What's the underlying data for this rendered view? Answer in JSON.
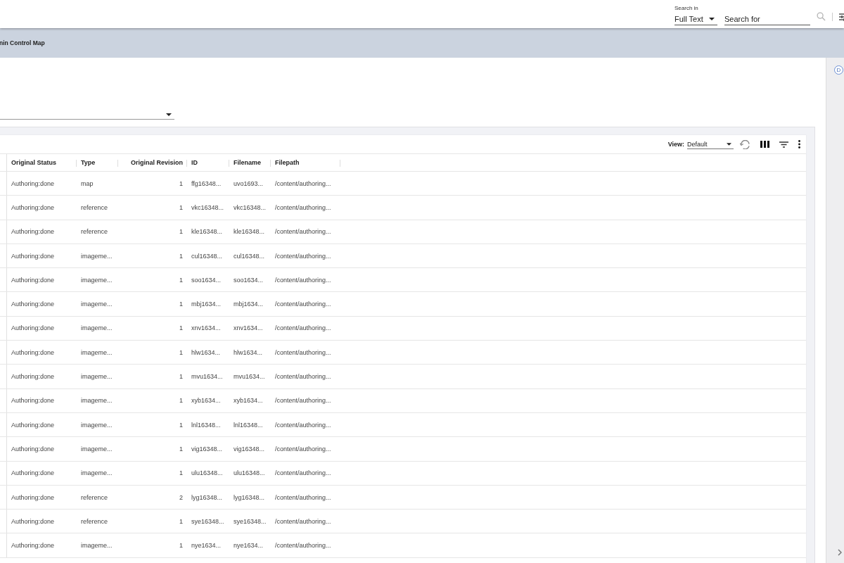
{
  "header": {
    "search_in_label": "Search in",
    "search_scope": "Full Text",
    "search_field": {
      "placeholder": "Search for"
    }
  },
  "breadcrumb": "nin Control Map",
  "side_panel": {
    "avatar": "D"
  },
  "toolbar": {
    "view_label": "View:",
    "view_value": "Default"
  },
  "table": {
    "columns": [
      "Original Status",
      "Type",
      "Original Revision",
      "ID",
      "Filename",
      "Filepath"
    ],
    "rows": [
      [
        "Authoring:done",
        "map",
        "1",
        "ffg16348...",
        "uvo1693...",
        "/content/authoring..."
      ],
      [
        "Authoring:done",
        "reference",
        "1",
        "vkc16348...",
        "vkc16348...",
        "/content/authoring..."
      ],
      [
        "Authoring:done",
        "reference",
        "1",
        "kle16348...",
        "kle16348...",
        "/content/authoring..."
      ],
      [
        "Authoring:done",
        "imageme...",
        "1",
        "cul16348...",
        "cul16348...",
        "/content/authoring..."
      ],
      [
        "Authoring:done",
        "imageme...",
        "1",
        "soo1634...",
        "soo1634...",
        "/content/authoring..."
      ],
      [
        "Authoring:done",
        "imageme...",
        "1",
        "mbj1634...",
        "mbj1634...",
        "/content/authoring..."
      ],
      [
        "Authoring:done",
        "imageme...",
        "1",
        "xnv1634...",
        "xnv1634...",
        "/content/authoring..."
      ],
      [
        "Authoring:done",
        "imageme...",
        "1",
        "hlw1634...",
        "hlw1634...",
        "/content/authoring..."
      ],
      [
        "Authoring:done",
        "imageme...",
        "1",
        "mvu1634...",
        "mvu1634...",
        "/content/authoring..."
      ],
      [
        "Authoring:done",
        "imageme...",
        "1",
        "xyb1634...",
        "xyb1634...",
        "/content/authoring..."
      ],
      [
        "Authoring:done",
        "imageme...",
        "1",
        "lnl16348...",
        "lnl16348...",
        "/content/authoring..."
      ],
      [
        "Authoring:done",
        "imageme...",
        "1",
        "vig16348...",
        "vig16348...",
        "/content/authoring..."
      ],
      [
        "Authoring:done",
        "imageme...",
        "1",
        "ulu16348...",
        "ulu16348...",
        "/content/authoring..."
      ],
      [
        "Authoring:done",
        "reference",
        "2",
        "lyg16348...",
        "lyg16348...",
        "/content/authoring..."
      ],
      [
        "Authoring:done",
        "reference",
        "1",
        "sye16348...",
        "sye16348...",
        "/content/authoring..."
      ],
      [
        "Authoring:done",
        "imageme...",
        "1",
        "nye1634...",
        "nye1634...",
        "/content/authoring..."
      ]
    ]
  }
}
